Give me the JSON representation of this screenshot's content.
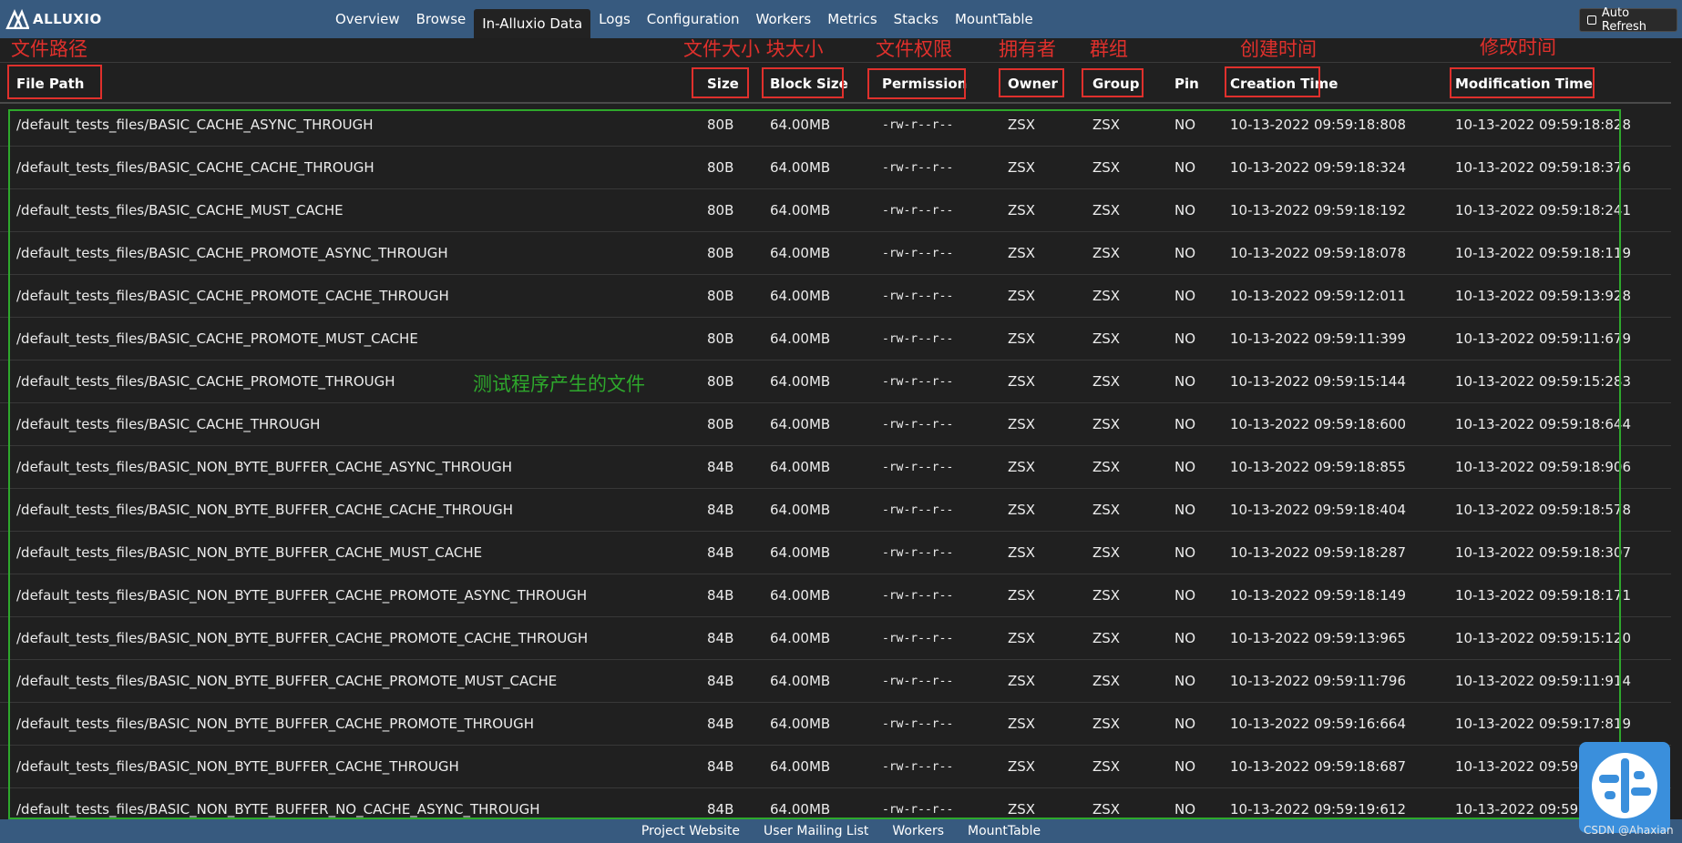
{
  "app": {
    "brand": "ALLUXIO"
  },
  "nav": {
    "items": [
      "Overview",
      "Browse",
      "In-Alluxio Data",
      "Logs",
      "Configuration",
      "Workers",
      "Metrics",
      "Stacks",
      "MountTable"
    ],
    "active_index": 2,
    "auto_refresh_label": "Auto Refresh"
  },
  "annotations": {
    "file_path": "文件路径",
    "size_block": "文件大小 块大小",
    "permission": "文件权限",
    "owner": "拥有者",
    "group": "群组",
    "creation_time": "创建时间",
    "modification_time": "修改时间",
    "generated_files": "测试程序产生的文件"
  },
  "table": {
    "columns": [
      "File Path",
      "Size",
      "Block Size",
      "Permission",
      "Owner",
      "Group",
      "Pin",
      "Creation Time",
      "Modification Time"
    ],
    "rows": [
      [
        "/default_tests_files/BASIC_CACHE_ASYNC_THROUGH",
        "80B",
        "64.00MB",
        "-rw-r--r--",
        "ZSX",
        "ZSX",
        "NO",
        "10-13-2022 09:59:18:808",
        "10-13-2022 09:59:18:828"
      ],
      [
        "/default_tests_files/BASIC_CACHE_CACHE_THROUGH",
        "80B",
        "64.00MB",
        "-rw-r--r--",
        "ZSX",
        "ZSX",
        "NO",
        "10-13-2022 09:59:18:324",
        "10-13-2022 09:59:18:376"
      ],
      [
        "/default_tests_files/BASIC_CACHE_MUST_CACHE",
        "80B",
        "64.00MB",
        "-rw-r--r--",
        "ZSX",
        "ZSX",
        "NO",
        "10-13-2022 09:59:18:192",
        "10-13-2022 09:59:18:241"
      ],
      [
        "/default_tests_files/BASIC_CACHE_PROMOTE_ASYNC_THROUGH",
        "80B",
        "64.00MB",
        "-rw-r--r--",
        "ZSX",
        "ZSX",
        "NO",
        "10-13-2022 09:59:18:078",
        "10-13-2022 09:59:18:119"
      ],
      [
        "/default_tests_files/BASIC_CACHE_PROMOTE_CACHE_THROUGH",
        "80B",
        "64.00MB",
        "-rw-r--r--",
        "ZSX",
        "ZSX",
        "NO",
        "10-13-2022 09:59:12:011",
        "10-13-2022 09:59:13:928"
      ],
      [
        "/default_tests_files/BASIC_CACHE_PROMOTE_MUST_CACHE",
        "80B",
        "64.00MB",
        "-rw-r--r--",
        "ZSX",
        "ZSX",
        "NO",
        "10-13-2022 09:59:11:399",
        "10-13-2022 09:59:11:679"
      ],
      [
        "/default_tests_files/BASIC_CACHE_PROMOTE_THROUGH",
        "80B",
        "64.00MB",
        "-rw-r--r--",
        "ZSX",
        "ZSX",
        "NO",
        "10-13-2022 09:59:15:144",
        "10-13-2022 09:59:15:283"
      ],
      [
        "/default_tests_files/BASIC_CACHE_THROUGH",
        "80B",
        "64.00MB",
        "-rw-r--r--",
        "ZSX",
        "ZSX",
        "NO",
        "10-13-2022 09:59:18:600",
        "10-13-2022 09:59:18:644"
      ],
      [
        "/default_tests_files/BASIC_NON_BYTE_BUFFER_CACHE_ASYNC_THROUGH",
        "84B",
        "64.00MB",
        "-rw-r--r--",
        "ZSX",
        "ZSX",
        "NO",
        "10-13-2022 09:59:18:855",
        "10-13-2022 09:59:18:906"
      ],
      [
        "/default_tests_files/BASIC_NON_BYTE_BUFFER_CACHE_CACHE_THROUGH",
        "84B",
        "64.00MB",
        "-rw-r--r--",
        "ZSX",
        "ZSX",
        "NO",
        "10-13-2022 09:59:18:404",
        "10-13-2022 09:59:18:578"
      ],
      [
        "/default_tests_files/BASIC_NON_BYTE_BUFFER_CACHE_MUST_CACHE",
        "84B",
        "64.00MB",
        "-rw-r--r--",
        "ZSX",
        "ZSX",
        "NO",
        "10-13-2022 09:59:18:287",
        "10-13-2022 09:59:18:307"
      ],
      [
        "/default_tests_files/BASIC_NON_BYTE_BUFFER_CACHE_PROMOTE_ASYNC_THROUGH",
        "84B",
        "64.00MB",
        "-rw-r--r--",
        "ZSX",
        "ZSX",
        "NO",
        "10-13-2022 09:59:18:149",
        "10-13-2022 09:59:18:171"
      ],
      [
        "/default_tests_files/BASIC_NON_BYTE_BUFFER_CACHE_PROMOTE_CACHE_THROUGH",
        "84B",
        "64.00MB",
        "-rw-r--r--",
        "ZSX",
        "ZSX",
        "NO",
        "10-13-2022 09:59:13:965",
        "10-13-2022 09:59:15:120"
      ],
      [
        "/default_tests_files/BASIC_NON_BYTE_BUFFER_CACHE_PROMOTE_MUST_CACHE",
        "84B",
        "64.00MB",
        "-rw-r--r--",
        "ZSX",
        "ZSX",
        "NO",
        "10-13-2022 09:59:11:796",
        "10-13-2022 09:59:11:914"
      ],
      [
        "/default_tests_files/BASIC_NON_BYTE_BUFFER_CACHE_PROMOTE_THROUGH",
        "84B",
        "64.00MB",
        "-rw-r--r--",
        "ZSX",
        "ZSX",
        "NO",
        "10-13-2022 09:59:16:664",
        "10-13-2022 09:59:17:819"
      ],
      [
        "/default_tests_files/BASIC_NON_BYTE_BUFFER_CACHE_THROUGH",
        "84B",
        "64.00MB",
        "-rw-r--r--",
        "ZSX",
        "ZSX",
        "NO",
        "10-13-2022 09:59:18:687",
        "10-13-2022 09:59:18"
      ],
      [
        "/default_tests_files/BASIC_NON_BYTE_BUFFER_NO_CACHE_ASYNC_THROUGH",
        "84B",
        "64.00MB",
        "-rw-r--r--",
        "ZSX",
        "ZSX",
        "NO",
        "10-13-2022 09:59:19:612",
        "10-13-2022 09:59:19"
      ]
    ]
  },
  "footer": {
    "links": [
      "Project Website",
      "User Mailing List",
      "Workers",
      "MountTable"
    ]
  },
  "watermark": "CSDN @Ahaxian",
  "colors": {
    "navbar": "#375a7f",
    "background": "#202020",
    "annotation_red": "#e0302c",
    "annotation_green": "#2ea82c"
  },
  "icons": {
    "brand": "alluxio-logo-icon",
    "floating": "assistant-icon"
  }
}
